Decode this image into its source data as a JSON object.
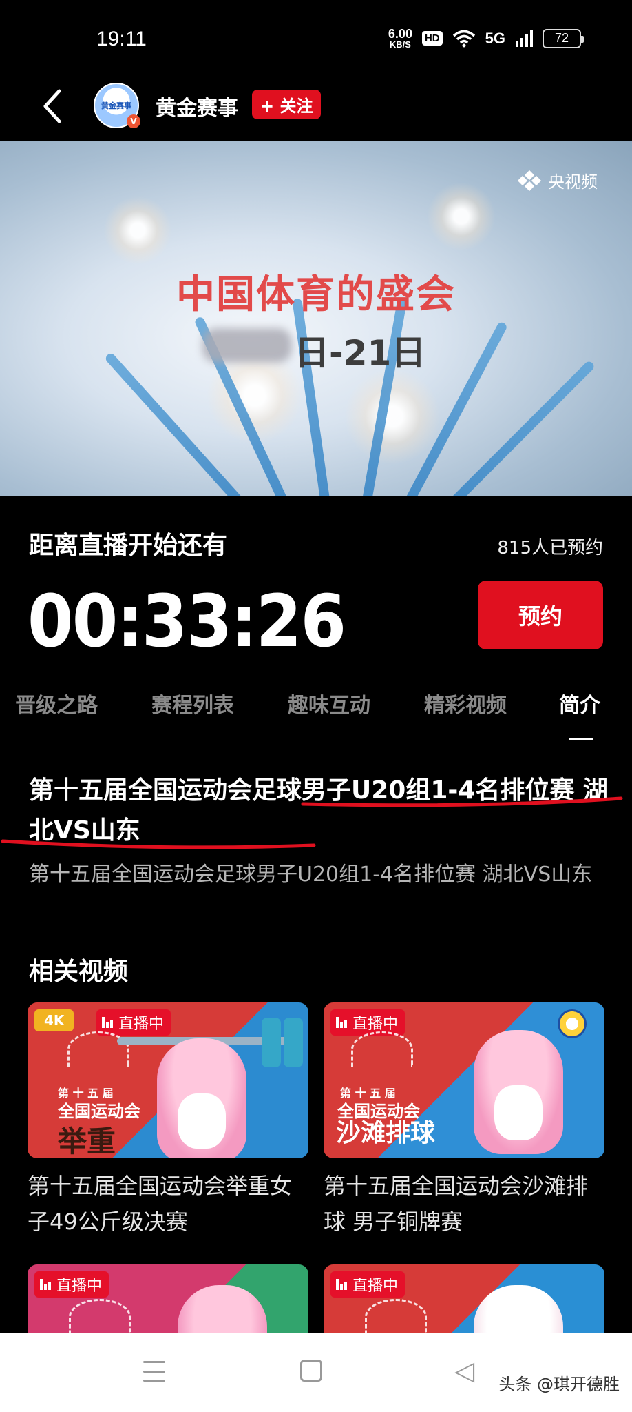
{
  "status_bar": {
    "time": "19:11",
    "net_speed": "6.00",
    "net_unit": "KB/S",
    "hd": "HD",
    "signal": "5G",
    "battery": "72"
  },
  "header": {
    "back_icon": "back-arrow-icon",
    "avatar_text": "黄金赛事",
    "channel_name": "黄金赛事",
    "follow_label": "+ 关注"
  },
  "banner": {
    "title": "中国体育的盛会",
    "date_text": "日-21日",
    "logo_text": "央视频"
  },
  "countdown": {
    "label": "距离直播开始还有",
    "reserved_count": "815人已预约",
    "time": "00:33:26",
    "reserve_button": "预约"
  },
  "tabs": [
    {
      "label": "晋级之路",
      "active": false
    },
    {
      "label": "赛程列表",
      "active": false
    },
    {
      "label": "趣味互动",
      "active": false
    },
    {
      "label": "精彩视频",
      "active": false
    },
    {
      "label": "简介",
      "active": true
    }
  ],
  "intro": {
    "title": "第十五届全国运动会足球男子U20组1-4名排位赛 湖北VS山东",
    "description": "第十五届全国运动会足球男子U20组1-4名排位赛 湖北VS山东",
    "annotation_color": "#e0101f"
  },
  "related": {
    "heading": "相关视频",
    "cards": [
      {
        "badge_4k": "4K",
        "badge_live": "直播中",
        "small_text": "第 十 五 届",
        "event_text": "全国运动会",
        "sport_text": "举重",
        "title": "第十五届全国运动会举重女子49公斤级决赛"
      },
      {
        "badge_live": "直播中",
        "small_text": "第 十 五 届",
        "event_text": "全国运动会",
        "sport_text": "沙滩排球",
        "title": "第十五届全国运动会沙滩排球 男子铜牌赛"
      },
      {
        "badge_live": "直播中",
        "title": ""
      },
      {
        "badge_live": "直播中",
        "title": ""
      }
    ]
  },
  "watermark": "头条 @琪开德胜",
  "colors": {
    "accent": "#e0101f",
    "background": "#000000",
    "tab_inactive": "#8a8a8a"
  }
}
